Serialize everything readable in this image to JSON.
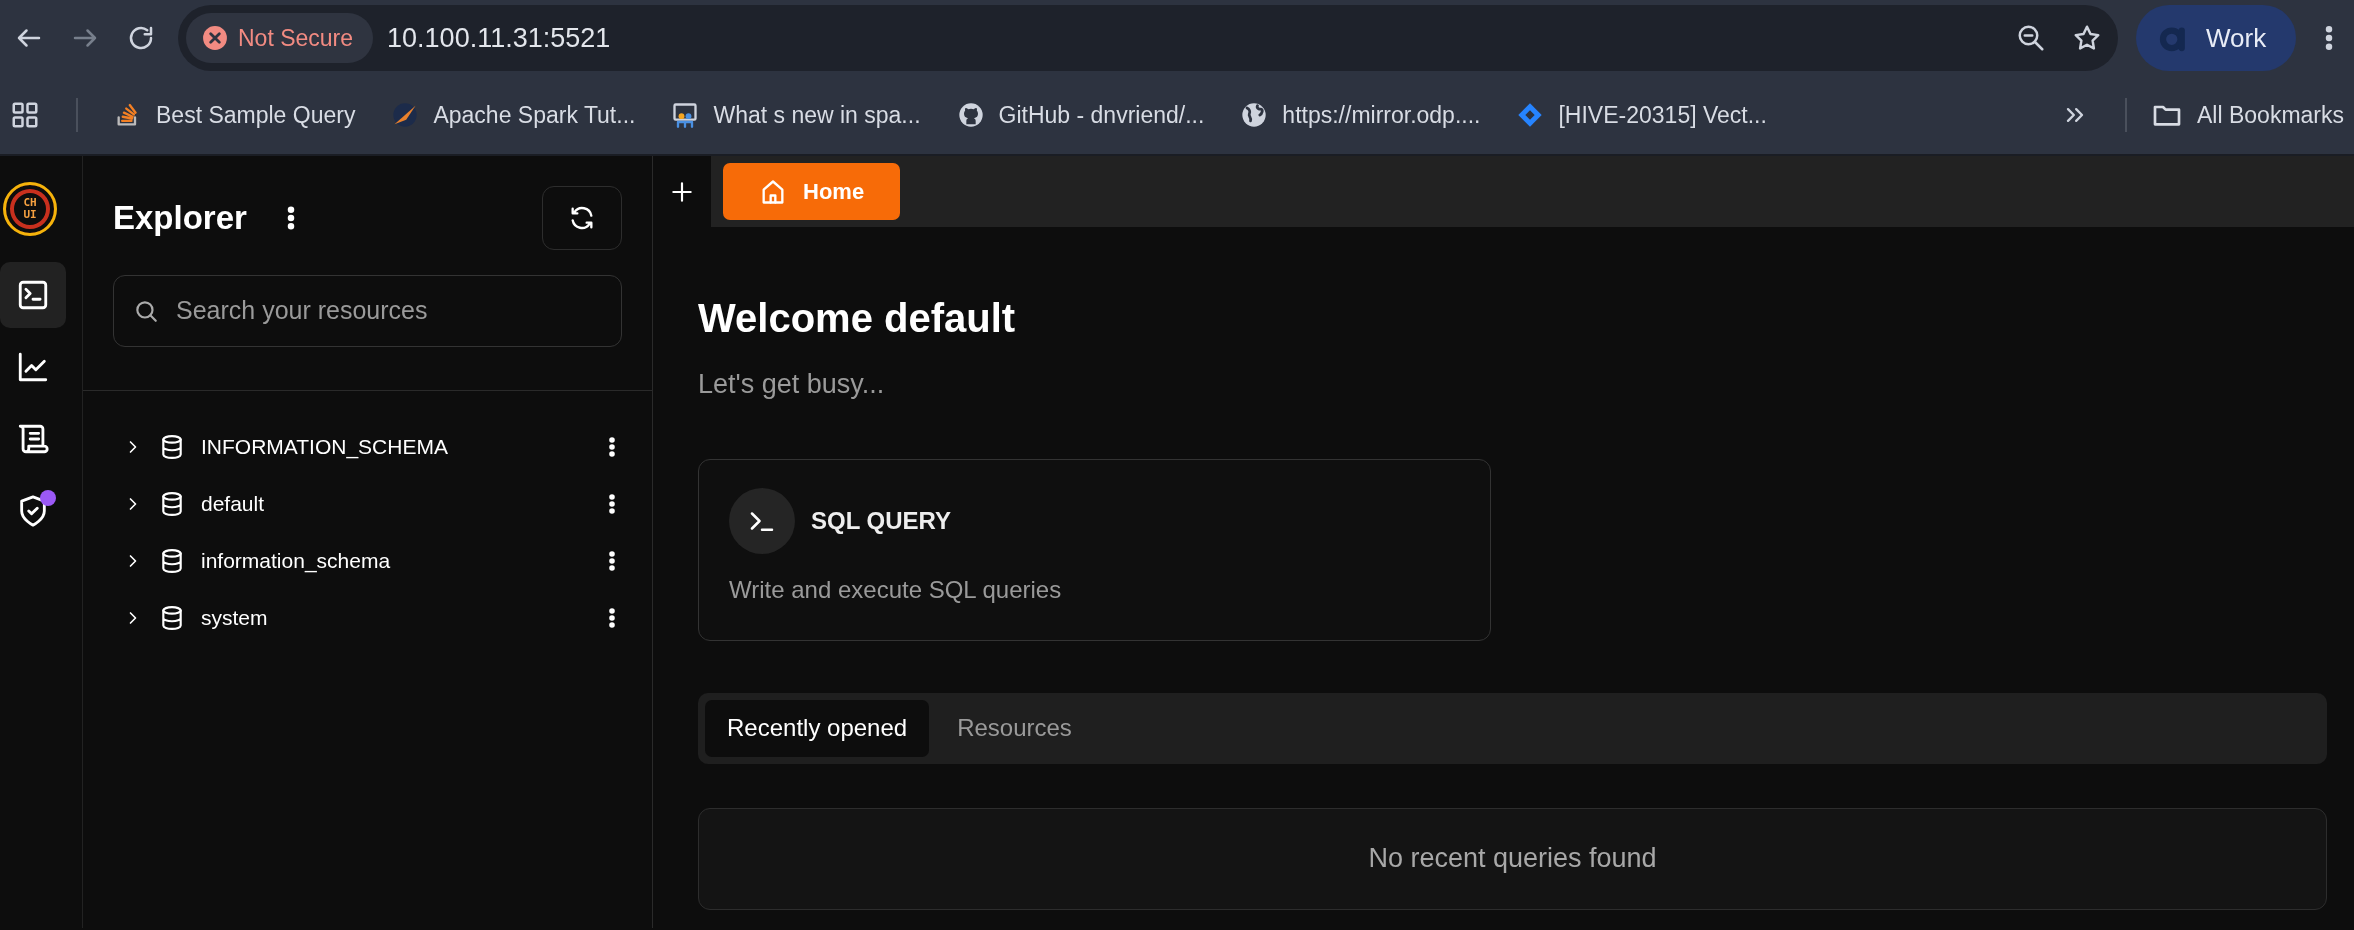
{
  "browser": {
    "security": "Not Secure",
    "url": "10.100.11.31:5521",
    "profile": "Work",
    "bookmarks": [
      {
        "label": "Best Sample Query",
        "kind": "stack"
      },
      {
        "label": "Apache Spark Tut...",
        "kind": "spark"
      },
      {
        "label": "What s new in spa...",
        "kind": "slides"
      },
      {
        "label": "GitHub - dnvriend/...",
        "kind": "github"
      },
      {
        "label": "https://mirror.odp....",
        "kind": "globe"
      },
      {
        "label": "[HIVE-20315] Vect...",
        "kind": "jira"
      }
    ],
    "all_bookmarks": "All Bookmarks"
  },
  "rail": {
    "logo": "CH UI",
    "items": [
      {
        "kind": "terminal",
        "selected": true,
        "badge": false
      },
      {
        "kind": "chart",
        "selected": false,
        "badge": false
      },
      {
        "kind": "scroll",
        "selected": false,
        "badge": false
      },
      {
        "kind": "shield",
        "selected": false,
        "badge": true
      }
    ]
  },
  "explorer": {
    "title": "Explorer",
    "search": {
      "placeholder": "Search your resources"
    },
    "items": [
      {
        "label": "INFORMATION_SCHEMA",
        "expanded": false
      },
      {
        "label": "default",
        "expanded": false
      },
      {
        "label": "information_schema",
        "expanded": false
      },
      {
        "label": "system",
        "expanded": false
      }
    ]
  },
  "tabs": [
    {
      "label": "Home",
      "selected": true
    }
  ],
  "welcome": {
    "title": "Welcome default",
    "subtitle": "Let's get busy..."
  },
  "card": {
    "title": "SQL QUERY",
    "description": "Write and execute SQL queries"
  },
  "view_tabs": [
    {
      "label": "Recently opened",
      "selected": true
    },
    {
      "label": "Resources",
      "selected": false
    }
  ],
  "empty_text": "No recent queries found"
}
